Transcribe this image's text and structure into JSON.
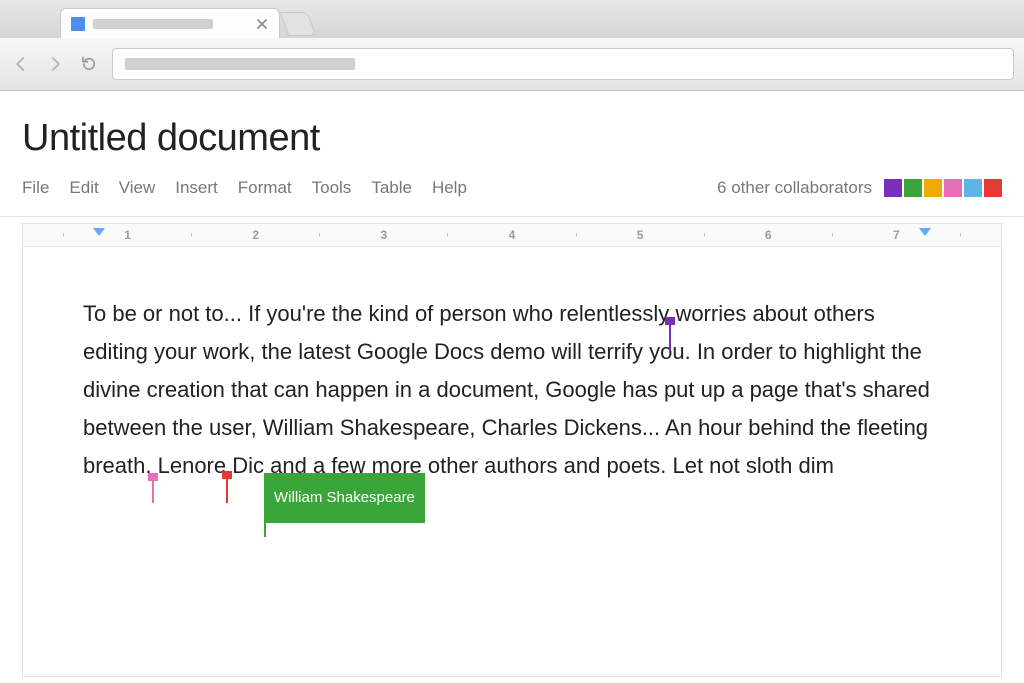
{
  "doc": {
    "title": "Untitled document",
    "menubar": [
      "File",
      "Edit",
      "View",
      "Insert",
      "Format",
      "Tools",
      "Table",
      "Help"
    ],
    "collaborators_text": "6 other collaborators",
    "collaborator_colors": [
      "#7b2fbf",
      "#3aa63a",
      "#f2a900",
      "#e86fb7",
      "#5fb4e6",
      "#e53935"
    ],
    "ruler_numbers": [
      "1",
      "2",
      "3",
      "4",
      "5",
      "6",
      "7"
    ]
  },
  "body": {
    "seg1": "To be or not to...  If you're the kind of person who relentlessly",
    "seg2": "worries about others editing your work, the latest Google Docs demo will terrify you. In order to highlight the divine creation that can happen in a document, Google has put up a page that's shared between the user, William Shakespeare, Charles Dickens... An hour behind the fleeting breath,",
    "seg3": " Lenore",
    "seg4": " Dic",
    "seg5": " and a few more other authors and poets. Let not sloth dim"
  },
  "cursors": {
    "purple": "#7b2fbf",
    "pink": "#e86fb7",
    "red": "#e53935",
    "green": "#3aa63a",
    "label_text": "William Shakespeare"
  }
}
